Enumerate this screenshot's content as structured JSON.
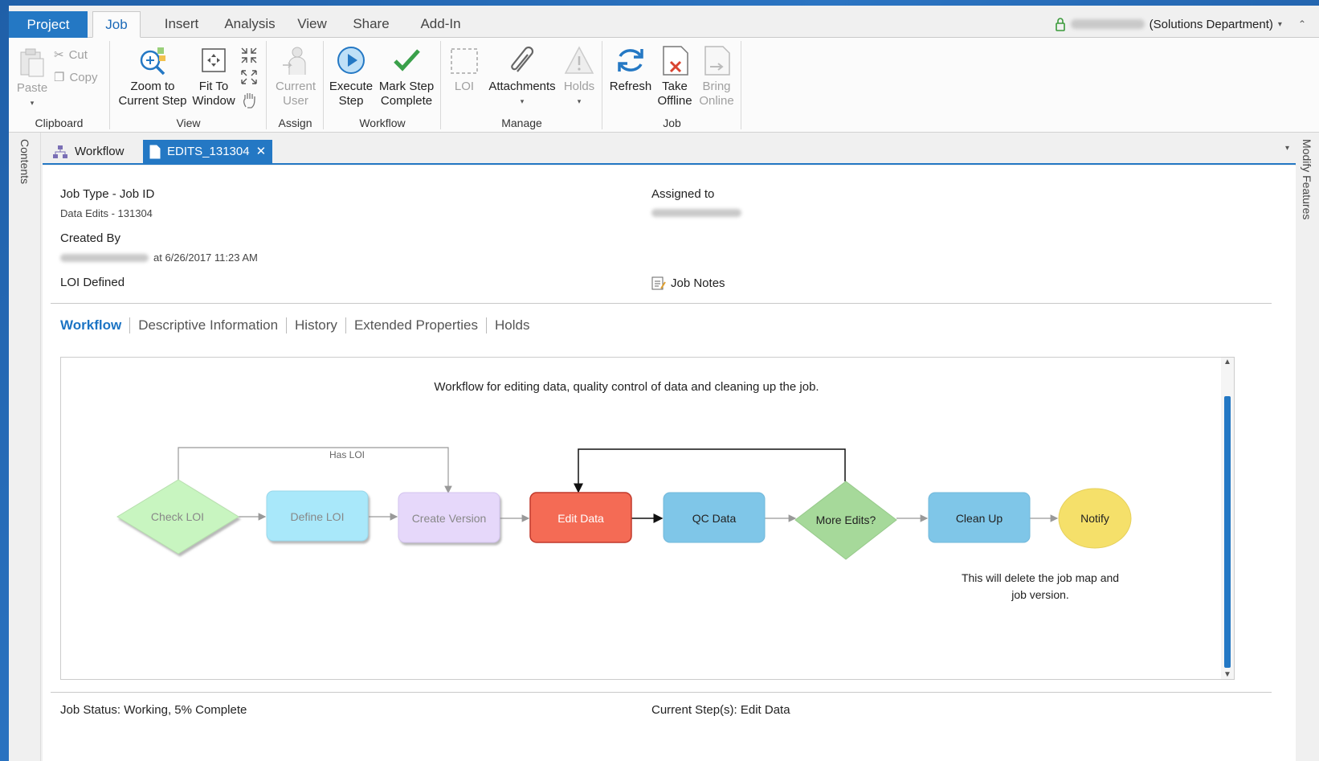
{
  "ribbon_tabs": [
    "Project",
    "Job",
    "Insert",
    "Analysis",
    "View",
    "Share",
    "Add-In"
  ],
  "user": {
    "department": "(Solutions Department)"
  },
  "clipboard": {
    "paste": "Paste",
    "cut": "Cut",
    "copy": "Copy",
    "label": "Clipboard"
  },
  "view": {
    "zoom_1": "Zoom to",
    "zoom_2": "Current Step",
    "fit_1": "Fit To",
    "fit_2": "Window",
    "label": "View"
  },
  "assign": {
    "current_1": "Current",
    "current_2": "User",
    "label": "Assign"
  },
  "workflow_group": {
    "execute_1": "Execute",
    "execute_2": "Step",
    "mark_1": "Mark Step",
    "mark_2": "Complete",
    "label": "Workflow"
  },
  "manage": {
    "loi": "LOI",
    "attachments": "Attachments",
    "holds": "Holds",
    "label": "Manage"
  },
  "job_group": {
    "refresh": "Refresh",
    "offline_1": "Take",
    "offline_2": "Offline",
    "online_1": "Bring",
    "online_2": "Online",
    "label": "Job"
  },
  "side": {
    "left": "Contents",
    "right": "Modify Features"
  },
  "doc_tabs": {
    "workflow": "Workflow",
    "edits": "EDITS_131304",
    "close": "✕"
  },
  "details": {
    "job_type_label": "Job Type - Job ID",
    "job_type_value": "Data Edits - 131304",
    "created_by_label": "Created By",
    "created_at": "at 6/26/2017 11:23 AM",
    "loi": "LOI Defined",
    "assigned_label": "Assigned to",
    "job_notes": "Job Notes"
  },
  "sub_tabs": [
    "Workflow",
    "Descriptive Information",
    "History",
    "Extended Properties",
    "Holds"
  ],
  "diagram": {
    "title": "Workflow for editing data, quality control of data and cleaning up the job.",
    "has_loi": "Has LOI",
    "nodes": {
      "check_loi": "Check LOI",
      "define_loi": "Define LOI",
      "create_version": "Create Version",
      "edit_data": "Edit Data",
      "qc_data": "QC Data",
      "more_edits": "More Edits?",
      "clean_up": "Clean Up",
      "notify": "Notify"
    },
    "note_1": "This will delete the job map and",
    "note_2": "job version."
  },
  "status": {
    "job_status": "Job Status: Working, 5% Complete",
    "current_step": "Current Step(s): Edit Data"
  }
}
